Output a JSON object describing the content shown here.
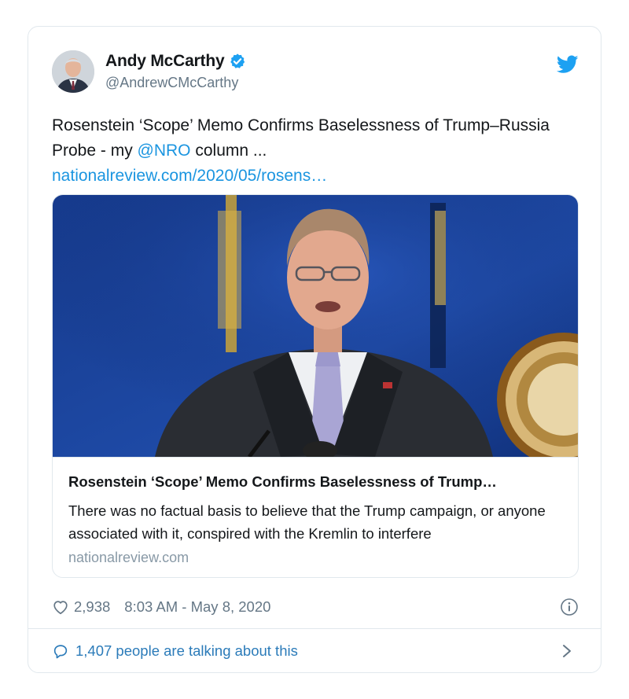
{
  "author": {
    "display_name": "Andy McCarthy",
    "handle": "@AndrewCMcCarthy",
    "verified": true,
    "avatar": "avatar-photo"
  },
  "tweet": {
    "text_before": "Rosenstein ‘Scope’ Memo Confirms Baselessness of Trump–Russia Probe - my ",
    "mention": "@NRO",
    "text_after": " column ...",
    "link": "nationalreview.com/2020/05/rosens…"
  },
  "link_card": {
    "image": "photo-rosenstein-at-podium",
    "title": "Rosenstein ‘Scope’ Memo Confirms Baselessness of Trump…",
    "description": "There was no factual basis to believe that the Trump campaign, or anyone associated with it, conspired with the Kremlin to interfere",
    "domain": "nationalreview.com"
  },
  "meta": {
    "likes": "2,938",
    "timestamp": "8:03 AM - May 8, 2020"
  },
  "footer": {
    "talking": "1,407 people are talking about this"
  },
  "icons": {
    "verified": "verified-badge-icon",
    "brand": "twitter-bird-icon",
    "like": "heart-icon",
    "info": "info-icon",
    "reply": "speech-bubble-icon",
    "more": "chevron-right-icon"
  },
  "colors": {
    "link": "#1b95e0",
    "muted": "#657786",
    "border": "#e1e8ed",
    "footer_link": "#2b7bb9"
  }
}
